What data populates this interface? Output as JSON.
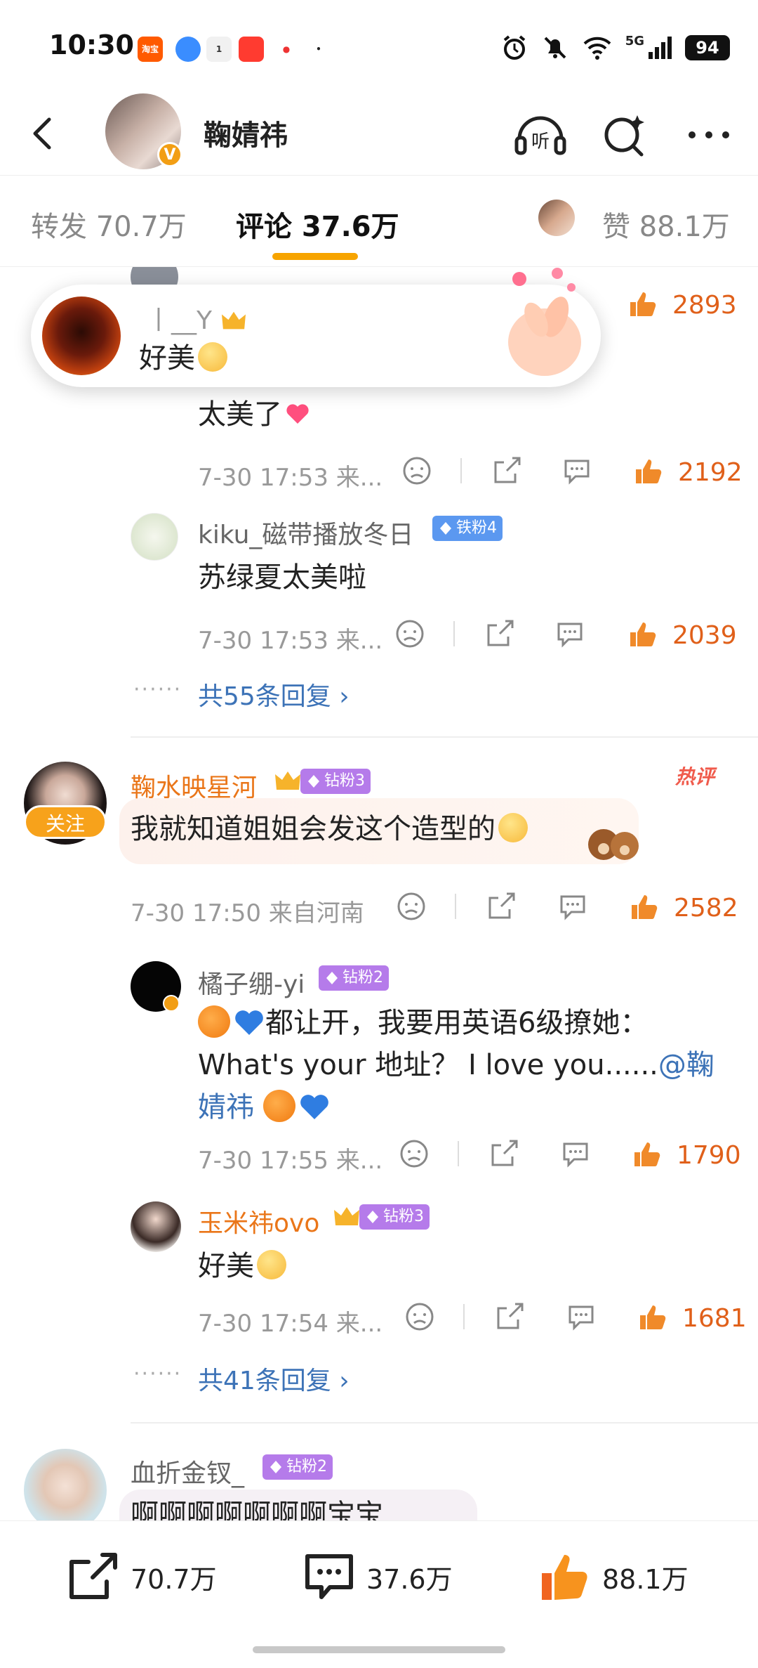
{
  "status": {
    "time": "10:30",
    "battery": "94",
    "network": "5G"
  },
  "header": {
    "user_name": "鞠婧祎",
    "verified_badge": "V"
  },
  "tabs": {
    "repost": "转发 70.7万",
    "comments": "评论 37.6万",
    "likes": "赞 88.1万"
  },
  "toast": {
    "user_name": "丨__Y",
    "text": "好美"
  },
  "comments": {
    "partial_reply_text": "太美了",
    "partial_reply_meta": "7-30 17:53 来...",
    "likes_top": "2893",
    "likes_r0": "2192",
    "reply_1": {
      "name": "kiku_磁带播放冬日",
      "badge": "铁粉4",
      "text": "苏绿夏太美啦",
      "meta": "7-30 17:53 来...",
      "likes": "2039"
    },
    "replies_link_1": "共55条回复",
    "c2": {
      "name": "鞠水映星河",
      "badge": "钻粉3",
      "hot": "热评",
      "follow": "关注",
      "text": "我就知道姐姐会发这个造型的",
      "meta": "7-30 17:50 来自河南",
      "likes": "2582"
    },
    "reply_2a": {
      "name": "橘子绷-yi",
      "badge": "钻粉2",
      "text_line1": "都让开，我要用英语6级撩她：",
      "text_line2": "What's your 地址？ I love you......",
      "mention_part1": "@鞠",
      "mention_part2": "婧祎",
      "meta": "7-30 17:55 来...",
      "likes": "1790"
    },
    "reply_2b": {
      "name": "玉米祎ovo",
      "badge": "钻粉3",
      "text": "好美",
      "meta": "7-30 17:54 来...",
      "likes": "1681"
    },
    "replies_link_2": "共41条回复",
    "c3": {
      "name": "血折金钗_",
      "badge": "钻粉2",
      "text": "啊啊啊啊啊啊啊宝宝"
    }
  },
  "bottom_bar": {
    "repost": "70.7万",
    "comment": "37.6万",
    "like": "88.1万"
  },
  "colors": {
    "accent": "#f7a400",
    "like": "#e0601a",
    "link": "#3d73b7",
    "name_highlight": "#ea7619"
  }
}
